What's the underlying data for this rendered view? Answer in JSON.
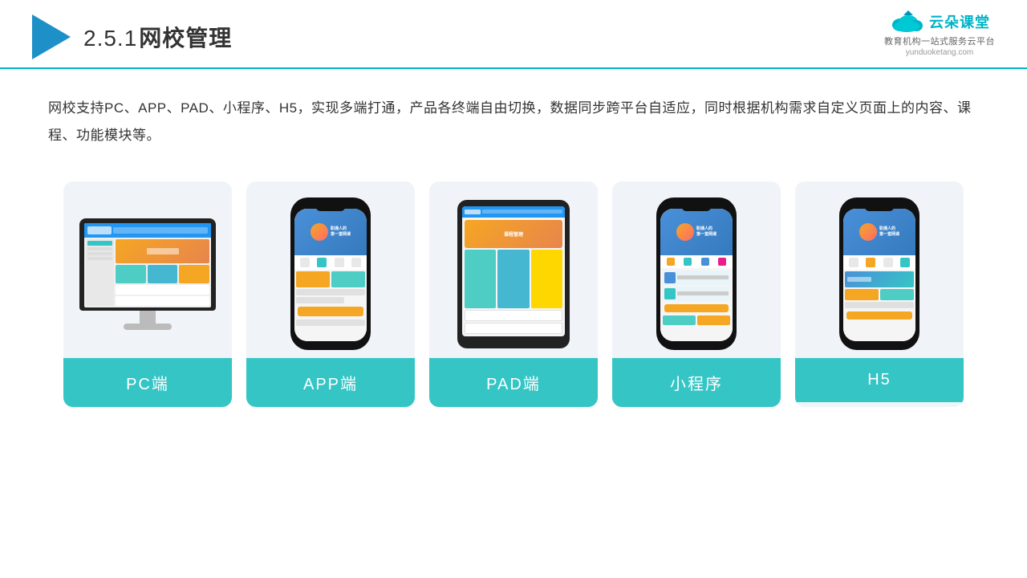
{
  "header": {
    "section_number": "2.5.1",
    "title": "网校管理",
    "brand_name": "云朵课堂",
    "brand_url": "yunduoketang.com",
    "brand_tagline": "教育机构一站\n式服务云平台"
  },
  "description": {
    "text": "网校支持PC、APP、PAD、小程序、H5，实现多端打通，产品各终端自由切换，数据同步跨平台自适应，同时根据机构需求自定义页面上的内容、课程、功能模块等。"
  },
  "cards": [
    {
      "id": "pc",
      "label": "PC端"
    },
    {
      "id": "app",
      "label": "APP端"
    },
    {
      "id": "pad",
      "label": "PAD端"
    },
    {
      "id": "miniprogram",
      "label": "小程序"
    },
    {
      "id": "h5",
      "label": "H5"
    }
  ],
  "colors": {
    "accent": "#36c5c5",
    "header_border": "#00b4c8",
    "logo_blue": "#1e90c8",
    "card_bg": "#f0f4f8",
    "text_dark": "#333"
  }
}
